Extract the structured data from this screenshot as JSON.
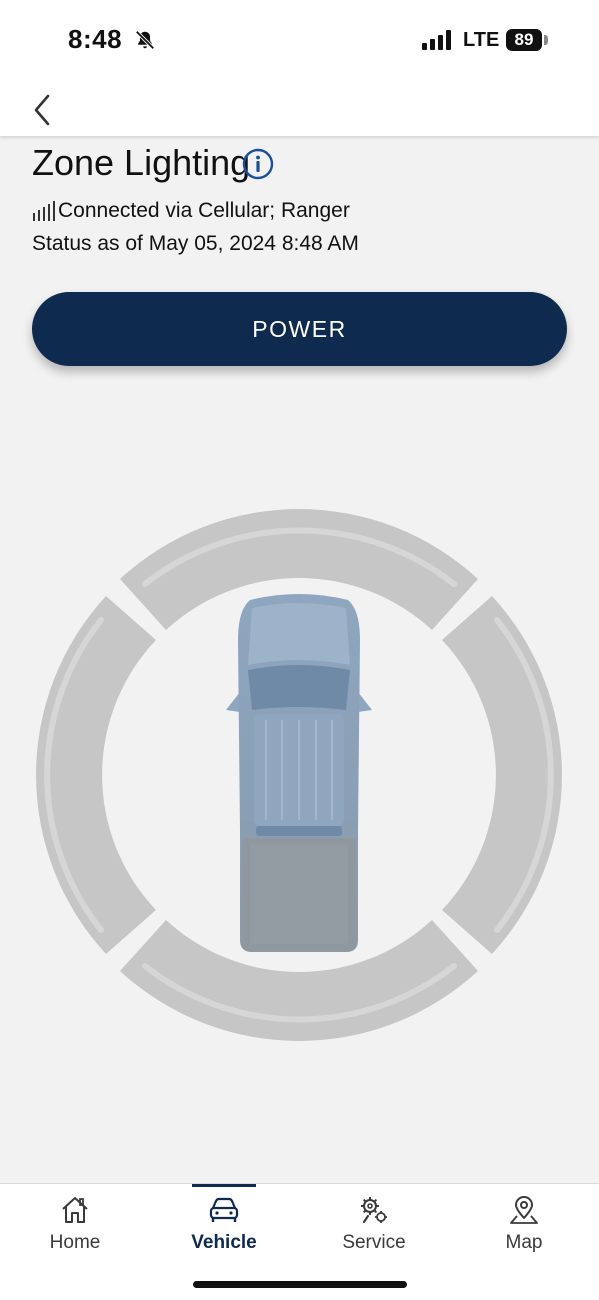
{
  "status_bar": {
    "time": "8:48",
    "network": "LTE",
    "battery": "89"
  },
  "header": {
    "title": "Zone Lighting",
    "connection": "Connected via Cellular; Ranger",
    "status": "Status as of May 05, 2024 8:48 AM"
  },
  "power_button": {
    "label": "POWER"
  },
  "colors": {
    "brand_navy": "#0e2a4f",
    "zone_inactive": "#c6c6c6",
    "background": "#f2f2f2"
  },
  "tabs": [
    {
      "label": "Home",
      "icon": "home-icon",
      "active": false
    },
    {
      "label": "Vehicle",
      "icon": "vehicle-icon",
      "active": true
    },
    {
      "label": "Service",
      "icon": "service-icon",
      "active": false
    },
    {
      "label": "Map",
      "icon": "map-pin-icon",
      "active": false
    }
  ]
}
